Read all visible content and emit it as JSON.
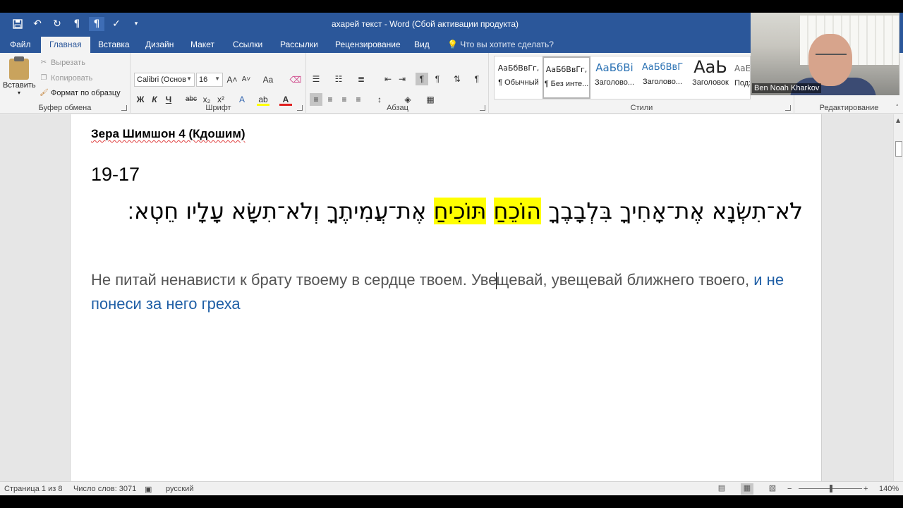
{
  "window": {
    "title": "ахарей текст - Word (Сбой активации продукта)"
  },
  "quick_access": {
    "icons": [
      "save-icon",
      "undo-icon",
      "redo-icon",
      "ltr-paragraph-icon",
      "rtl-paragraph-icon",
      "spelling-check-icon",
      "customize-qat-icon"
    ]
  },
  "tabs": [
    "Файл",
    "Главная",
    "Вставка",
    "Дизайн",
    "Макет",
    "Ссылки",
    "Рассылки",
    "Рецензирование",
    "Вид"
  ],
  "active_tab": "Главная",
  "tell_me": "Что вы хотите сделать?",
  "ribbon": {
    "clipboard": {
      "label": "Буфер обмена",
      "paste": "Вставить",
      "cut": "Вырезать",
      "copy": "Копировать",
      "format_painter": "Формат по образцу"
    },
    "font": {
      "label": "Шрифт",
      "font_name": "Calibri (Основ",
      "font_size": "16",
      "bold": "Ж",
      "italic": "К",
      "underline": "Ч",
      "strike": "abc",
      "subscript": "x₂",
      "superscript": "x²",
      "grow": "A˄",
      "shrink": "A˅",
      "case": "Aa"
    },
    "paragraph": {
      "label": "Абзац",
      "pilcrow": "¶"
    },
    "styles": {
      "label": "Стили",
      "items": [
        {
          "sample": "АаБбВвГг,",
          "name": "¶ Обычный"
        },
        {
          "sample": "АаБбВвГг,",
          "name": "¶ Без инте..."
        },
        {
          "sample": "АаБбВі",
          "name": "Заголово..."
        },
        {
          "sample": "АаБбВвГ",
          "name": "Заголово..."
        },
        {
          "sample": "АаЬ",
          "name": "Заголовок"
        },
        {
          "sample": "АаЕ",
          "name": "Подз"
        }
      ]
    },
    "editing": {
      "label": "Редактирование"
    }
  },
  "document": {
    "heading": "Зера Шимшон 4 (Кдошим)",
    "verse_ref": "19-17",
    "hebrew_before": "לֹא־תִשְׂנָא אֶת־אָחִיךָ בִּלְבָבֶךָ ",
    "hebrew_hl1": "הוֹכֵחַ",
    "hebrew_hl2": "תּוֹכִיחַ",
    "hebrew_after": " אֶת־עֲמִיתֶךָ וְלֹא־תִשָּׂא עָלָיו חֵטְא׃",
    "russian_part1": "Не питай ненависти к брату твоему в сердце твоем. Уве",
    "russian_part2": "щевай, увещевай ближнего твоего, ",
    "russian_blue": "и не понеси за него греха"
  },
  "status_bar": {
    "page": "Страница 1 из 8",
    "words": "Число слов: 3071",
    "language": "русский",
    "zoom": "140%",
    "zoom_level_percent": 140
  },
  "webcam": {
    "name": "Ben Noah Kharkov"
  },
  "colors": {
    "word_blue": "#2b579a",
    "highlight": "#ffff00",
    "blue_text": "#1f5fa6"
  }
}
